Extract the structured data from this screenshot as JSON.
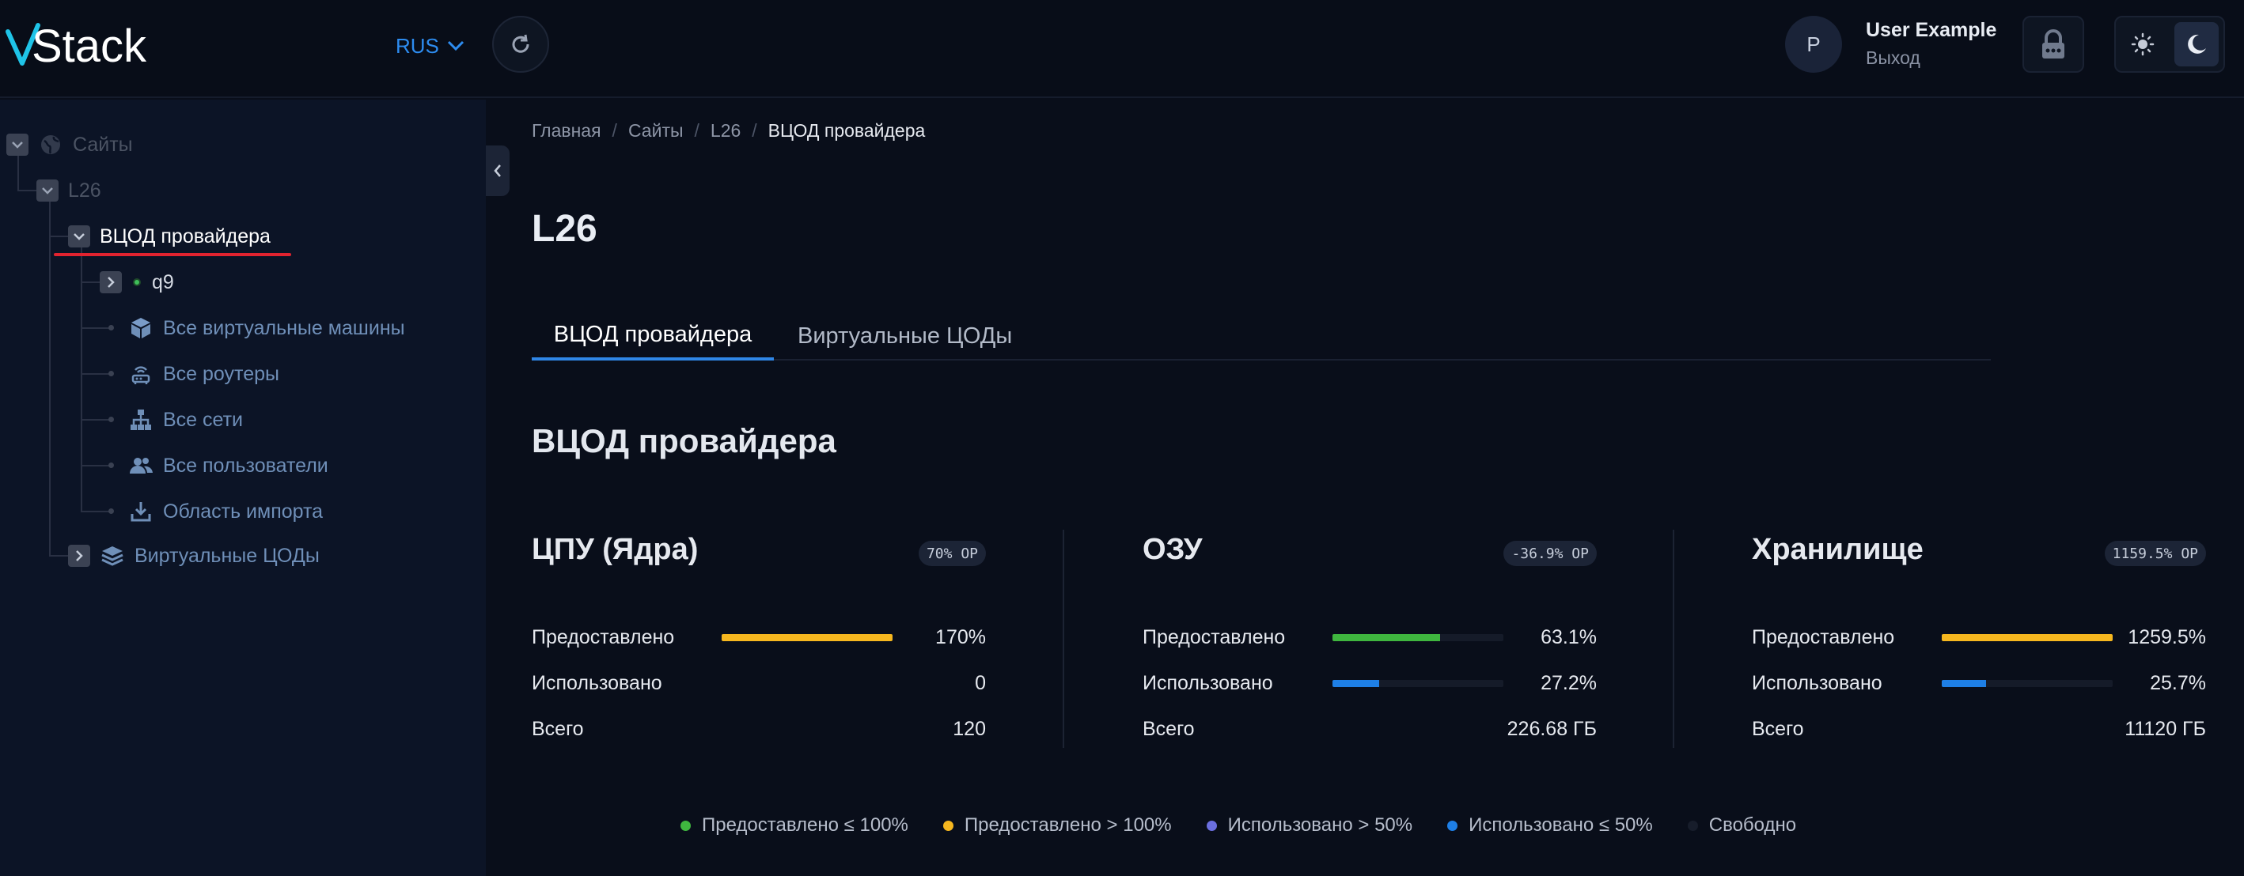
{
  "header": {
    "logo_text": "vStack",
    "language": "RUS",
    "user": {
      "avatar_letter": "P",
      "name": "User Example",
      "logout": "Выход"
    }
  },
  "sidebar": {
    "items": [
      {
        "label": "Сайты",
        "icon": "globe-icon",
        "state": "muted",
        "toggle": "expanded"
      },
      {
        "label": "L26",
        "state": "muted",
        "toggle": "expanded"
      },
      {
        "label": "ВЦОД провайдера",
        "state": "active",
        "toggle": "expanded"
      },
      {
        "label": "q9",
        "icon": "status-dot-icon",
        "state": "normal",
        "toggle": "collapsed"
      },
      {
        "label": "Все виртуальные машины",
        "icon": "cube-icon",
        "state": "link"
      },
      {
        "label": "Все роутеры",
        "icon": "router-icon",
        "state": "link"
      },
      {
        "label": "Все сети",
        "icon": "network-icon",
        "state": "link"
      },
      {
        "label": "Все пользователи",
        "icon": "users-icon",
        "state": "link"
      },
      {
        "label": "Область импорта",
        "icon": "download-icon",
        "state": "link"
      },
      {
        "label": "Виртуальные ЦОДы",
        "icon": "layers-icon",
        "state": "link",
        "toggle": "collapsed"
      }
    ]
  },
  "breadcrumb": [
    "Главная",
    "Сайты",
    "L26",
    "ВЦОД провайдера"
  ],
  "page_title": "L26",
  "tabs": [
    {
      "label": "ВЦОД провайдера",
      "active": true
    },
    {
      "label": "Виртуальные ЦОДы",
      "active": false
    }
  ],
  "section_title": "ВЦОД провайдера",
  "resources": [
    {
      "title": "ЦПУ (Ядра)",
      "badge": "70% OP",
      "rows": [
        {
          "label": "Предоставлено",
          "value": "170%",
          "bar": {
            "fill": 1.0,
            "color": "#f6b71f"
          }
        },
        {
          "label": "Использовано",
          "value": "0"
        },
        {
          "label": "Всего",
          "value": "120"
        }
      ]
    },
    {
      "title": "ОЗУ",
      "badge": "-36.9% OP",
      "rows": [
        {
          "label": "Предоставлено",
          "value": "63.1%",
          "bar": {
            "fill": 0.631,
            "color": "#3fb63f"
          }
        },
        {
          "label": "Использовано",
          "value": "27.2%",
          "bar": {
            "fill": 0.272,
            "color": "#1e7fe6"
          }
        },
        {
          "label": "Всего",
          "value": "226.68 ГБ"
        }
      ]
    },
    {
      "title": "Хранилище",
      "badge": "1159.5% OP",
      "rows": [
        {
          "label": "Предоставлено",
          "value": "1259.5%",
          "bar": {
            "fill": 1.0,
            "color": "#f6b71f"
          }
        },
        {
          "label": "Использовано",
          "value": "25.7%",
          "bar": {
            "fill": 0.257,
            "color": "#1e7fe6"
          }
        },
        {
          "label": "Всего",
          "value": "11120 ГБ"
        }
      ]
    }
  ],
  "legend": [
    {
      "label": "Предоставлено ≤ 100%",
      "color": "#3fb63f"
    },
    {
      "label": "Предоставлено > 100%",
      "color": "#f6b71f"
    },
    {
      "label": "Использовано > 50%",
      "color": "#6b6fe0"
    },
    {
      "label": "Использовано ≤ 50%",
      "color": "#1e7fe6"
    },
    {
      "label": "Свободно",
      "color": "#171d2b"
    }
  ]
}
